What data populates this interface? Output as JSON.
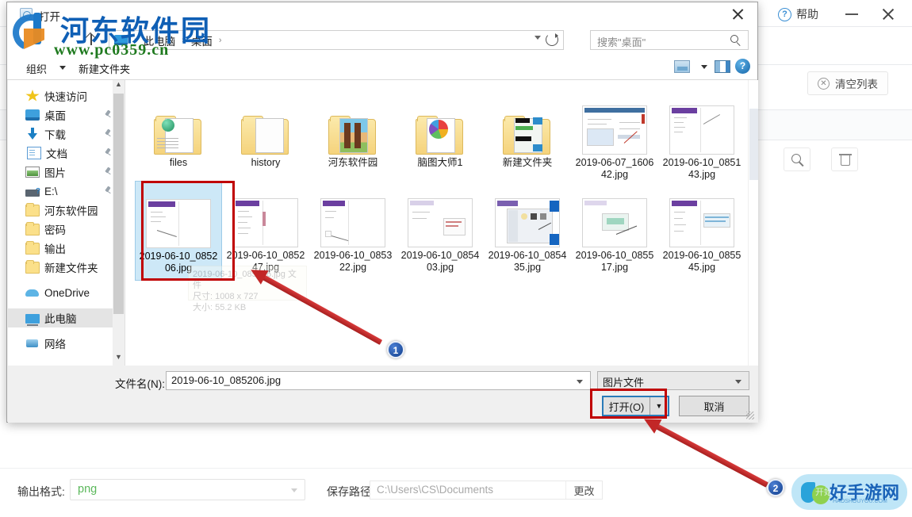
{
  "background_app": {
    "help_label": "帮助",
    "clear_list_label": "清空列表",
    "minimize_icon": "minimize-icon",
    "close_icon": "close-icon",
    "toolbar_icons": [
      "search-icon",
      "trash-icon"
    ],
    "bottom_bar": {
      "output_format_label": "输出格式:",
      "output_format_value": "png",
      "save_path_label": "保存路径:",
      "save_path_value": "C:\\Users\\CS\\Documents",
      "change_button": "更改"
    },
    "watermark_logo": {
      "text": "好手游网",
      "subtext": "开始游戏之旅",
      "tagline": "HAOSHOUYOU.COM"
    }
  },
  "watermark": {
    "site_name": "河东软件园",
    "url": "www.pc0359.cn"
  },
  "dialog": {
    "title": "打开",
    "close_icon": "close-icon",
    "nav": {
      "up_icon": "up-arrow-icon",
      "breadcrumbs": [
        "此电脑",
        "桌面"
      ],
      "dropdown_icon": "chevron-down-icon",
      "refresh_icon": "refresh-icon",
      "search_placeholder": "搜索\"桌面\"",
      "search_icon": "search-icon"
    },
    "toolbar": {
      "organize_label": "组织",
      "new_folder_label": "新建文件夹",
      "view_icon": "view-layout-icon",
      "preview_pane_icon": "preview-pane-icon",
      "help_icon": "help-icon"
    },
    "sidebar": [
      {
        "label": "快速访问",
        "icon": "star-icon",
        "pinned": false,
        "selected": false
      },
      {
        "label": "桌面",
        "icon": "desktop-icon",
        "pinned": true,
        "selected": false
      },
      {
        "label": "下载",
        "icon": "download-icon",
        "pinned": true,
        "selected": false
      },
      {
        "label": "文档",
        "icon": "document-icon",
        "pinned": true,
        "selected": false
      },
      {
        "label": "图片",
        "icon": "pictures-icon",
        "pinned": true,
        "selected": false
      },
      {
        "label": "E:\\",
        "icon": "drive-icon",
        "pinned": true,
        "selected": false
      },
      {
        "label": "河东软件园",
        "icon": "folder-icon",
        "pinned": false,
        "selected": false
      },
      {
        "label": "密码",
        "icon": "folder-icon",
        "pinned": false,
        "selected": false
      },
      {
        "label": "输出",
        "icon": "folder-icon",
        "pinned": false,
        "selected": false
      },
      {
        "label": "新建文件夹",
        "icon": "folder-icon",
        "pinned": false,
        "selected": false
      },
      {
        "label": "OneDrive",
        "icon": "cloud-icon",
        "pinned": false,
        "selected": false
      },
      {
        "label": "此电脑",
        "icon": "pc-icon",
        "pinned": false,
        "selected": true
      },
      {
        "label": "网络",
        "icon": "network-icon",
        "pinned": false,
        "selected": false
      }
    ],
    "files": [
      {
        "name": "files",
        "type": "folder",
        "selected": false
      },
      {
        "name": "history",
        "type": "folder",
        "selected": false
      },
      {
        "name": "河东软件园",
        "type": "folder",
        "selected": false
      },
      {
        "name": "脑图大师1",
        "type": "folder",
        "selected": false
      },
      {
        "name": "新建文件夹",
        "type": "folder",
        "selected": false
      },
      {
        "name": "2019-06-07_160642.jpg",
        "type": "image",
        "selected": false
      },
      {
        "name": "2019-06-10_085143.jpg",
        "type": "image",
        "selected": false
      },
      {
        "name": "2019-06-10_085206.jpg",
        "type": "image",
        "selected": true
      },
      {
        "name": "2019-06-10_085247.jpg",
        "type": "image",
        "selected": false
      },
      {
        "name": "2019-06-10_085322.jpg",
        "type": "image",
        "selected": false
      },
      {
        "name": "2019-06-10_085403.jpg",
        "type": "image",
        "selected": false
      },
      {
        "name": "2019-06-10_085435.jpg",
        "type": "image",
        "selected": false
      },
      {
        "name": "2019-06-10_085517.jpg",
        "type": "image",
        "selected": false
      },
      {
        "name": "2019-06-10_085545.jpg",
        "type": "image",
        "selected": false
      }
    ],
    "tooltip": {
      "line1": "2019-06-10_085206.jpg 文件",
      "line2": "尺寸: 1008 x 727",
      "line3": "大小: 55.2 KB"
    },
    "footer": {
      "filename_label": "文件名(N):",
      "filename_value": "2019-06-10_085206.jpg",
      "filetype_value": "图片文件",
      "open_button": "打开(O)",
      "open_dropdown_icon": "caret-down-icon",
      "cancel_button": "取消"
    }
  },
  "annotations": {
    "badge_1": "1",
    "badge_2": "2",
    "highlight_color": "#c00000",
    "arrow_color": "#c22727"
  }
}
